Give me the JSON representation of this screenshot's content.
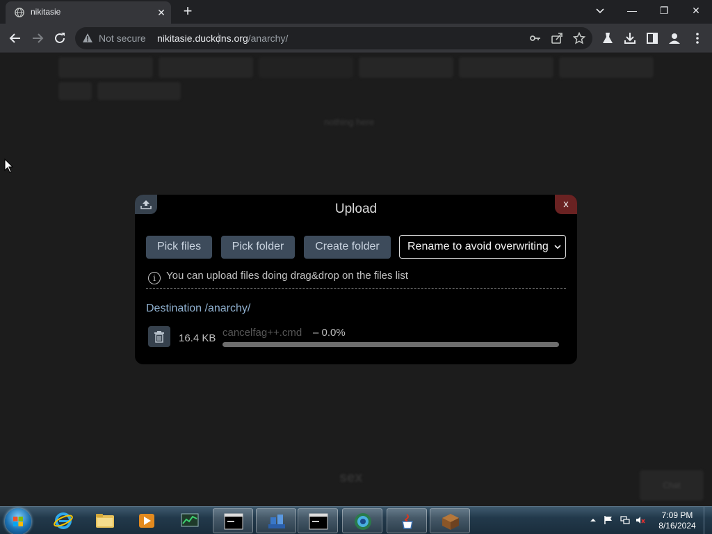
{
  "browser": {
    "tab_title": "nikitasie",
    "tab_close": "✕",
    "new_tab": "+",
    "security_label": "Not secure",
    "url_host": "nikitasie.duckdns.org",
    "url_path": "/anarchy/",
    "window_min": "—",
    "window_restore": "❐",
    "window_close": "✕"
  },
  "page": {
    "background_note_blurred": "nothing here",
    "footer_blurred": "sex",
    "corner_btn_blurred": "Chat"
  },
  "upload_dialog": {
    "title": "Upload",
    "close_label": "x",
    "pick_files": "Pick files",
    "pick_folder": "Pick folder",
    "create_folder": "Create folder",
    "overwrite_mode": "Rename to avoid overwriting",
    "info_icon": "i",
    "info_text": "You can upload files doing drag&drop on the files list",
    "destination": "Destination /anarchy/",
    "file": {
      "size": "16.4 KB",
      "name": "cancelfag++.cmd",
      "progress_text": "– 0.0%",
      "progress_fraction": 0.0
    }
  },
  "taskbar": {
    "apps": [
      "internet-explorer",
      "file-explorer",
      "media-player",
      "task-manager",
      "command-prompt",
      "network-app",
      "command-prompt",
      "browser",
      "java",
      "minecraft"
    ],
    "time": "7:09 PM",
    "date": "8/16/2024"
  },
  "colors": {
    "accent_button": "#3d4b5b",
    "close_button": "#6a2222",
    "destination_link": "#8fb0cf"
  }
}
